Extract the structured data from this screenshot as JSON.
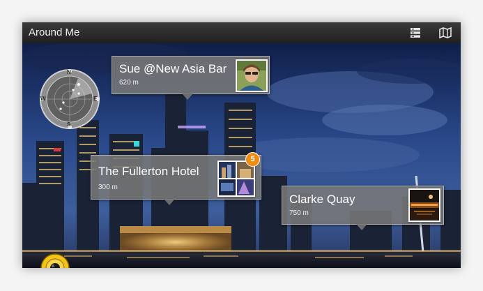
{
  "app": {
    "title": "Around Me",
    "toolbar": {
      "list_icon": "list-view-icon",
      "map_icon": "map-icon"
    }
  },
  "radar": {
    "icon": "compass-radar-icon",
    "letters": [
      "N",
      "E",
      "S",
      "W"
    ]
  },
  "pois": [
    {
      "name": "Sue @New Asia Bar",
      "distance": "620 m",
      "thumb": "profile-photo"
    },
    {
      "name": "The Fullerton Hotel",
      "distance": "300 m",
      "badge": "5",
      "thumb": "photo-collage"
    },
    {
      "name": "Clarke Quay",
      "distance": "750 m",
      "thumb": "place-photo"
    }
  ],
  "camera_button": {
    "icon": "camera-lens-icon"
  },
  "colors": {
    "titlebar": "#2a2a2a",
    "callout": "#787878",
    "badge": "#f08c14",
    "camera_button": "#f2c41a"
  }
}
